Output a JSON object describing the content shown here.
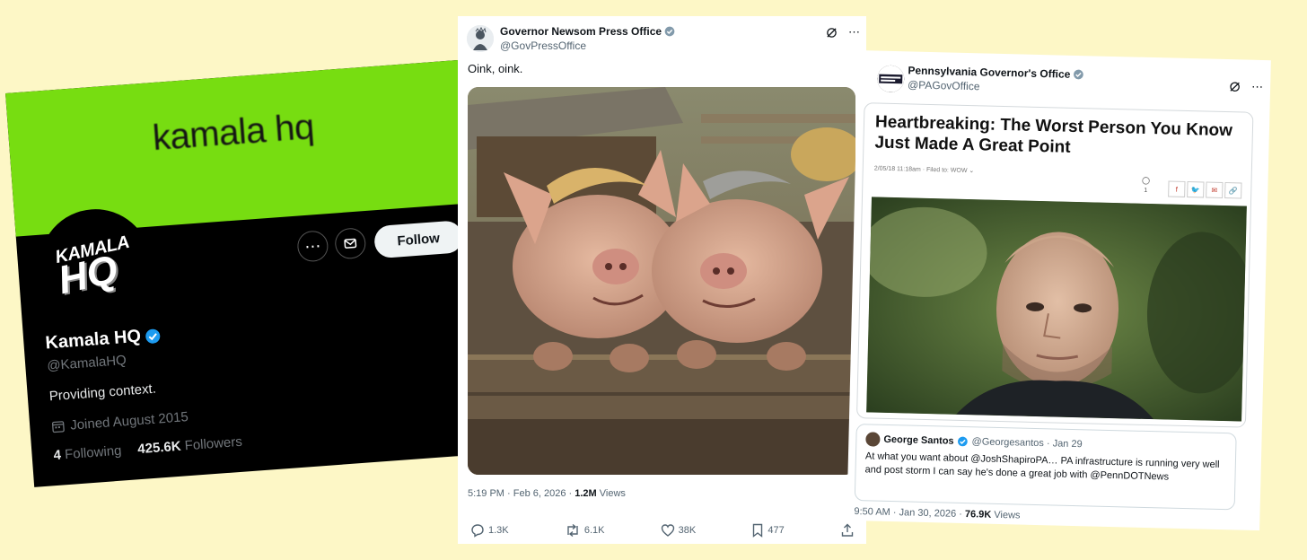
{
  "card_profile": {
    "banner_text": "kamala hq",
    "avatar_text_line1": "KAMALA",
    "avatar_text_line2": "HQ",
    "follow_label": "Follow",
    "display_name": "Kamala HQ",
    "handle": "@KamalaHQ",
    "bio": "Providing context.",
    "joined": "Joined August 2015",
    "following_count": "4",
    "following_label": "Following",
    "followers_count": "425.6K",
    "followers_label": "Followers",
    "colors": {
      "banner": "#77dd11",
      "verified": "#1d9bf0"
    }
  },
  "tweet_newsom": {
    "display_name": "Governor Newsom Press Office",
    "handle": "@GovPressOffice",
    "text": "Oink, oink.",
    "time": "5:19 PM · Feb 6, 2026 · ",
    "views_count": "1.2M",
    "views_label": " Views",
    "actions": {
      "replies": "1.3K",
      "reposts": "6.1K",
      "likes": "38K",
      "bookmarks": "477"
    },
    "image_icon": "pigs-photo"
  },
  "tweet_pa": {
    "display_name": "Pennsylvania Governor's Office",
    "handle": "@PAGovOffice",
    "article": {
      "headline": "Heartbreaking: The Worst Person You Know Just Made A Great Point",
      "meta": "2/05/18 11:18am · Filed to: WOW ⌄",
      "comment_count": "1",
      "share_icons": [
        "f",
        "🐦",
        "✉",
        "🔗"
      ]
    },
    "quote": {
      "display_name": "George Santos",
      "handle": "@Georgesantos · Jan 29",
      "text": "At what you want about @JoshShapiroPA… PA infrastructure is running very well and post storm I can say he's done a great job with @PennDOTNews"
    },
    "time": "9:50 AM · Jan 30, 2026 · ",
    "views_count": "76.9K",
    "views_label": " Views"
  }
}
